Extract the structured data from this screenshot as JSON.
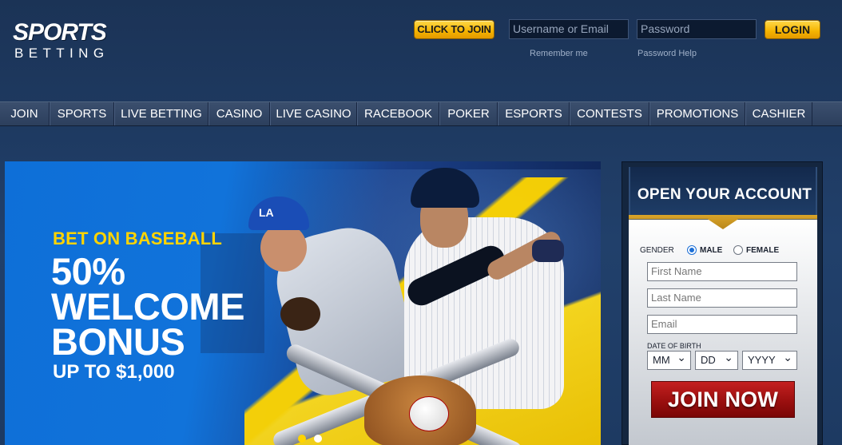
{
  "header": {
    "logo_top": "SPORTS",
    "logo_bottom": "BETTING",
    "click_to_join": "CLICK TO JOIN",
    "username_placeholder": "Username or Email",
    "password_placeholder": "Password",
    "login": "LOGIN",
    "remember_me": "Remember me",
    "password_help": "Password Help"
  },
  "nav": {
    "items": [
      {
        "label": "JOIN"
      },
      {
        "label": "SPORTS"
      },
      {
        "label": "LIVE BETTING"
      },
      {
        "label": "CASINO"
      },
      {
        "label": "LIVE CASINO"
      },
      {
        "label": "RACEBOOK"
      },
      {
        "label": "POKER"
      },
      {
        "label": "ESPORTS"
      },
      {
        "label": "CONTESTS"
      },
      {
        "label": "PROMOTIONS"
      },
      {
        "label": "CASHIER"
      }
    ]
  },
  "banner": {
    "kicker": "BET ON BASEBALL",
    "line1": "50%",
    "line2": "WELCOME",
    "line3": "BONUS",
    "subline": "UP TO $1,000",
    "cap_logo": "LA",
    "slides_total": 2,
    "slide_active": 1
  },
  "account": {
    "title": "OPEN YOUR ACCOUNT",
    "gender_label": "GENDER",
    "gender_options": [
      "MALE",
      "FEMALE"
    ],
    "gender_selected": "MALE",
    "first_name_placeholder": "First Name",
    "last_name_placeholder": "Last Name",
    "email_placeholder": "Email",
    "dob_label": "DATE OF BIRTH",
    "month": "MM",
    "day": "DD",
    "year": "YYYY",
    "join_now": "JOIN NOW"
  },
  "colors": {
    "accent_yellow": "#f5b400",
    "join_red": "#9b0f0f",
    "background_navy": "#1b3356"
  }
}
